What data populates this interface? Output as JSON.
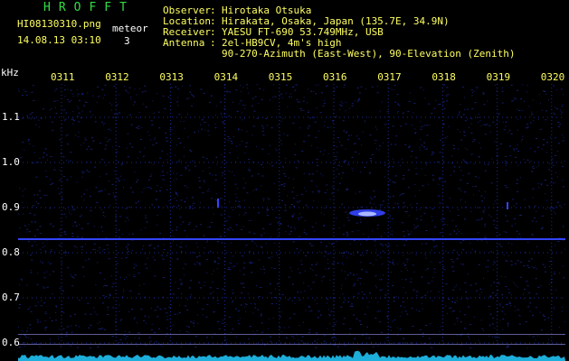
{
  "program": "HROFFT",
  "file_name": "HI08130310.png",
  "datetime": "14.08.13 03:10",
  "meteor_label": "meteor",
  "meteor_count": "3",
  "info": [
    {
      "key": "Observer",
      "value": "Hirotaka Otsuka"
    },
    {
      "key": "Location",
      "value": "Hirakata, Osaka, Japan (135.7E, 34.9N)"
    },
    {
      "key": "Receiver",
      "value": "YAESU FT-690 53.749MHz, USB"
    },
    {
      "key": "Antenna",
      "value": "2el-HB9CV, 4m's high"
    },
    {
      "key": "",
      "value": "90-270-Azimuth (East-West), 90-Elevation (Zenith)"
    }
  ],
  "y_axis_unit": "kHz",
  "time_ticks": [
    "0311",
    "0312",
    "0313",
    "0314",
    "0315",
    "0316",
    "0317",
    "0318",
    "0319",
    "0320"
  ],
  "freq_ticks": [
    "1.1",
    "1.0",
    "0.9",
    "0.8",
    "0.7",
    "0.6"
  ],
  "colors": {
    "background": "#000000",
    "noise": "#1a2a9a",
    "carrier": "#3344ff",
    "meteor": "#aab8ff",
    "baseline": "#22ccff",
    "grid": "#ffff60"
  }
}
